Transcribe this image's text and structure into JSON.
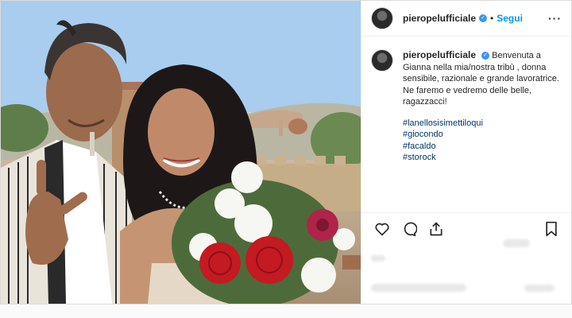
{
  "post": {
    "username": "pieropelufficiale",
    "separator": "•",
    "follow_label": "Segui",
    "more_label": "···",
    "caption": "Benvenuta a Gianna nella mia/nostra tribù , donna sensibile, razionale e grande lavoratrice. Ne faremo e vedremo delle belle, ragazzacci!",
    "hashtags": [
      "#lanellosisimettiloqui",
      "#giocondo",
      "#facaldo",
      "#storock"
    ]
  },
  "icons": {
    "verified": "verified-badge-icon",
    "like": "heart-icon",
    "comment": "comment-icon",
    "share": "share-icon",
    "save": "bookmark-icon"
  },
  "colors": {
    "link": "#0095f6",
    "hashtag": "#00376b",
    "verified": "#3897f0",
    "border": "#dbdbdb"
  }
}
